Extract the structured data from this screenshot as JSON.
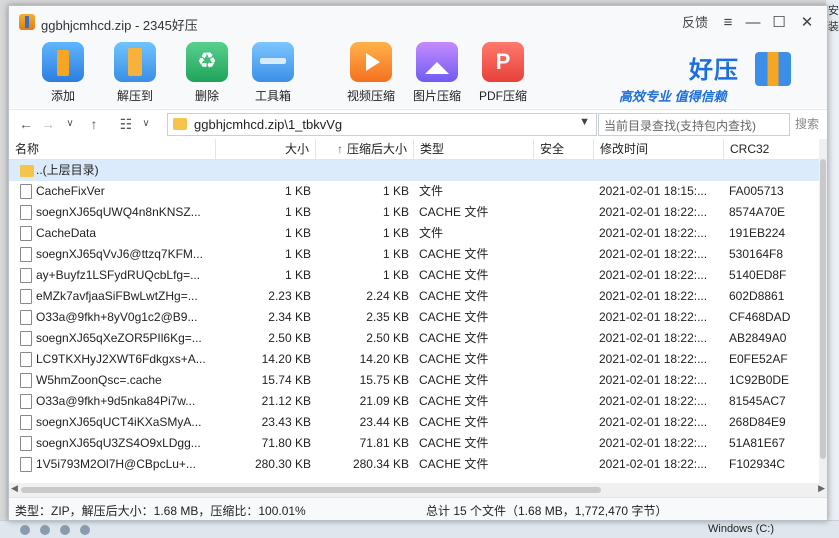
{
  "window": {
    "title": "ggbhjcmhcd.zip - 2345好压",
    "feedback": "反馈",
    "menu_icon": "≡",
    "min_icon": "—",
    "max_icon": "☐",
    "close_icon": "✕"
  },
  "toolbar": {
    "add": "添加",
    "extract": "解压到",
    "delete": "删除",
    "toolbox": "工具箱",
    "video": "视频压缩",
    "image": "图片压缩",
    "pdf": "PDF压缩"
  },
  "brand": {
    "name": "好压",
    "slogan": "高效专业  值得信赖"
  },
  "address": {
    "path": "ggbhjcmhcd.zip\\1_tbkvVg",
    "search_placeholder": "当前目录查找(支持包内查找)",
    "search_button": "搜索",
    "view_icon": "☷"
  },
  "columns": {
    "name": "名称",
    "size": "大小",
    "packed": "压缩后大小",
    "type": "类型",
    "security": "安全",
    "modified": "修改时间",
    "crc": "CRC32",
    "sort_icon": "↑"
  },
  "parent_row": "..(上层目录)",
  "files": [
    {
      "name": "CacheFixVer",
      "size": "1 KB",
      "packed": "1 KB",
      "type": "文件",
      "modified": "2021-02-01 18:15:...",
      "crc": "FA005713"
    },
    {
      "name": "soegnXJ65qUWQ4n8nKNSZ...",
      "size": "1 KB",
      "packed": "1 KB",
      "type": "CACHE 文件",
      "modified": "2021-02-01 18:22:...",
      "crc": "8574A70E"
    },
    {
      "name": "CacheData",
      "size": "1 KB",
      "packed": "1 KB",
      "type": "文件",
      "modified": "2021-02-01 18:22:...",
      "crc": "191EB224"
    },
    {
      "name": "soegnXJ65qVvJ6@ttzq7KFM...",
      "size": "1 KB",
      "packed": "1 KB",
      "type": "CACHE 文件",
      "modified": "2021-02-01 18:22:...",
      "crc": "530164F8"
    },
    {
      "name": "ay+Buyfz1LSFydRUQcbLfg=...",
      "size": "1 KB",
      "packed": "1 KB",
      "type": "CACHE 文件",
      "modified": "2021-02-01 18:22:...",
      "crc": "5140ED8F"
    },
    {
      "name": "eMZk7avfjaaSiFBwLwtZHg=...",
      "size": "2.23 KB",
      "packed": "2.24 KB",
      "type": "CACHE 文件",
      "modified": "2021-02-01 18:22:...",
      "crc": "602D8861"
    },
    {
      "name": "O33a@9fkh+8yV0g1c2@B9...",
      "size": "2.34 KB",
      "packed": "2.35 KB",
      "type": "CACHE 文件",
      "modified": "2021-02-01 18:22:...",
      "crc": "CF468DAD"
    },
    {
      "name": "soegnXJ65qXeZOR5PIl6Kg=...",
      "size": "2.50 KB",
      "packed": "2.50 KB",
      "type": "CACHE 文件",
      "modified": "2021-02-01 18:22:...",
      "crc": "AB2849A0"
    },
    {
      "name": "LC9TKXHyJ2XWT6Fdkgxs+A...",
      "size": "14.20 KB",
      "packed": "14.20 KB",
      "type": "CACHE 文件",
      "modified": "2021-02-01 18:22:...",
      "crc": "E0FE52AF"
    },
    {
      "name": "W5hmZoonQsc=.cache",
      "size": "15.74 KB",
      "packed": "15.75 KB",
      "type": "CACHE 文件",
      "modified": "2021-02-01 18:22:...",
      "crc": "1C92B0DE"
    },
    {
      "name": "O33a@9fkh+9d5nka84Pi7w...",
      "size": "21.12 KB",
      "packed": "21.09 KB",
      "type": "CACHE 文件",
      "modified": "2021-02-01 18:22:...",
      "crc": "81545AC7"
    },
    {
      "name": "soegnXJ65qUCT4iKXaSMyA...",
      "size": "23.43 KB",
      "packed": "23.44 KB",
      "type": "CACHE 文件",
      "modified": "2021-02-01 18:22:...",
      "crc": "268D84E9"
    },
    {
      "name": "soegnXJ65qU3ZS4O9xLDgg...",
      "size": "71.80 KB",
      "packed": "71.81 KB",
      "type": "CACHE 文件",
      "modified": "2021-02-01 18:22:...",
      "crc": "51A81E67"
    },
    {
      "name": "1V5i793M2Ol7H@CBpcLu+...",
      "size": "280.30 KB",
      "packed": "280.34 KB",
      "type": "CACHE 文件",
      "modified": "2021-02-01 18:22:...",
      "crc": "F102934C"
    }
  ],
  "status": {
    "left": "类型：ZIP，解压后大小：1.68 MB，压缩比：100.01%",
    "right": "总计 15 个文件（1.68 MB，1,772,470 字节）"
  },
  "desktop": {
    "right_text": "安装",
    "taskbar_text": "Windows (C:)"
  }
}
